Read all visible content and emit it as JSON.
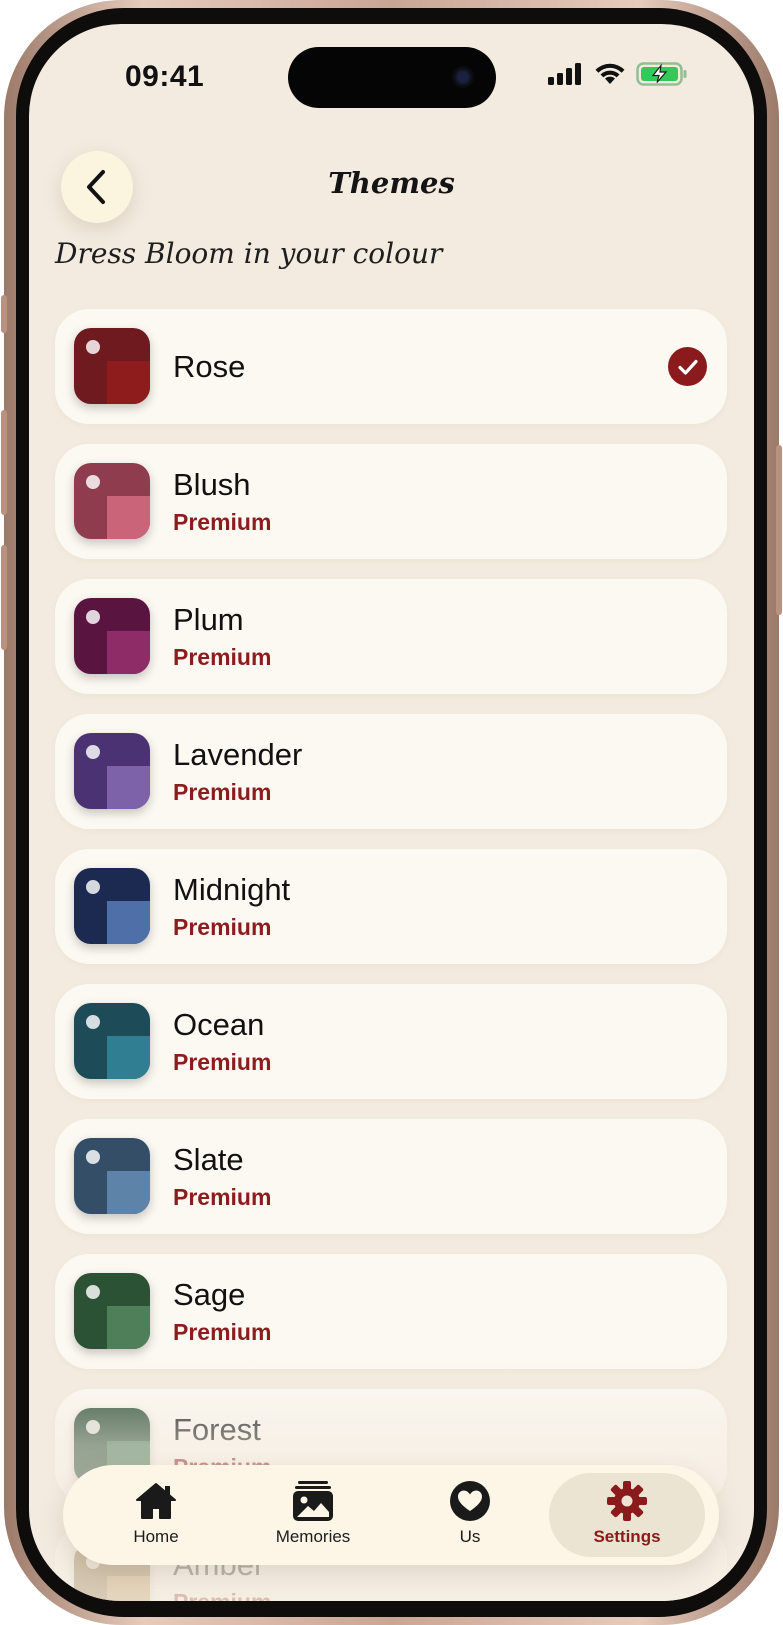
{
  "status_bar": {
    "time": "09:41"
  },
  "header": {
    "title": "Themes",
    "back_icon": "chevron-left-icon"
  },
  "subtitle": "Dress Bloom in your colour",
  "themes": [
    {
      "name": "Rose",
      "badge": "",
      "selected": true,
      "color_base": "#6e1a1e",
      "color_inner": "#8f1c1d"
    },
    {
      "name": "Blush",
      "badge": "Premium",
      "selected": false,
      "color_base": "#8f3c4e",
      "color_inner": "#c96479"
    },
    {
      "name": "Plum",
      "badge": "Premium",
      "selected": false,
      "color_base": "#5a1440",
      "color_inner": "#8e2c67"
    },
    {
      "name": "Lavender",
      "badge": "Premium",
      "selected": false,
      "color_base": "#4b3373",
      "color_inner": "#7d62a9"
    },
    {
      "name": "Midnight",
      "badge": "Premium",
      "selected": false,
      "color_base": "#1c2a52",
      "color_inner": "#4e6fa7"
    },
    {
      "name": "Ocean",
      "badge": "Premium",
      "selected": false,
      "color_base": "#1d4b58",
      "color_inner": "#2f7e91"
    },
    {
      "name": "Slate",
      "badge": "Premium",
      "selected": false,
      "color_base": "#334e66",
      "color_inner": "#5e83a8"
    },
    {
      "name": "Sage",
      "badge": "Premium",
      "selected": false,
      "color_base": "#2c5236",
      "color_inner": "#4f7f58"
    },
    {
      "name": "Forest",
      "badge": "Premium",
      "selected": false,
      "color_base": "#244a33",
      "color_inner": "#3f7453"
    },
    {
      "name": "Amber",
      "badge": "Premium",
      "selected": false,
      "color_base": "#7a5b2a",
      "color_inner": "#b18a4a"
    }
  ],
  "selected_check_icon": "checkmark-icon",
  "tab_bar": {
    "tabs": [
      {
        "label": "Home",
        "icon": "home-icon",
        "active": false
      },
      {
        "label": "Memories",
        "icon": "photo-icon",
        "active": false
      },
      {
        "label": "Us",
        "icon": "heart-icon",
        "active": false
      },
      {
        "label": "Settings",
        "icon": "gear-icon",
        "active": true
      }
    ]
  },
  "colors": {
    "background": "#f3ebdf",
    "card": "#fcf8f2",
    "accent": "#8b1a1c",
    "tab_bar": "#fdf6e6",
    "battery": "#34c759"
  }
}
